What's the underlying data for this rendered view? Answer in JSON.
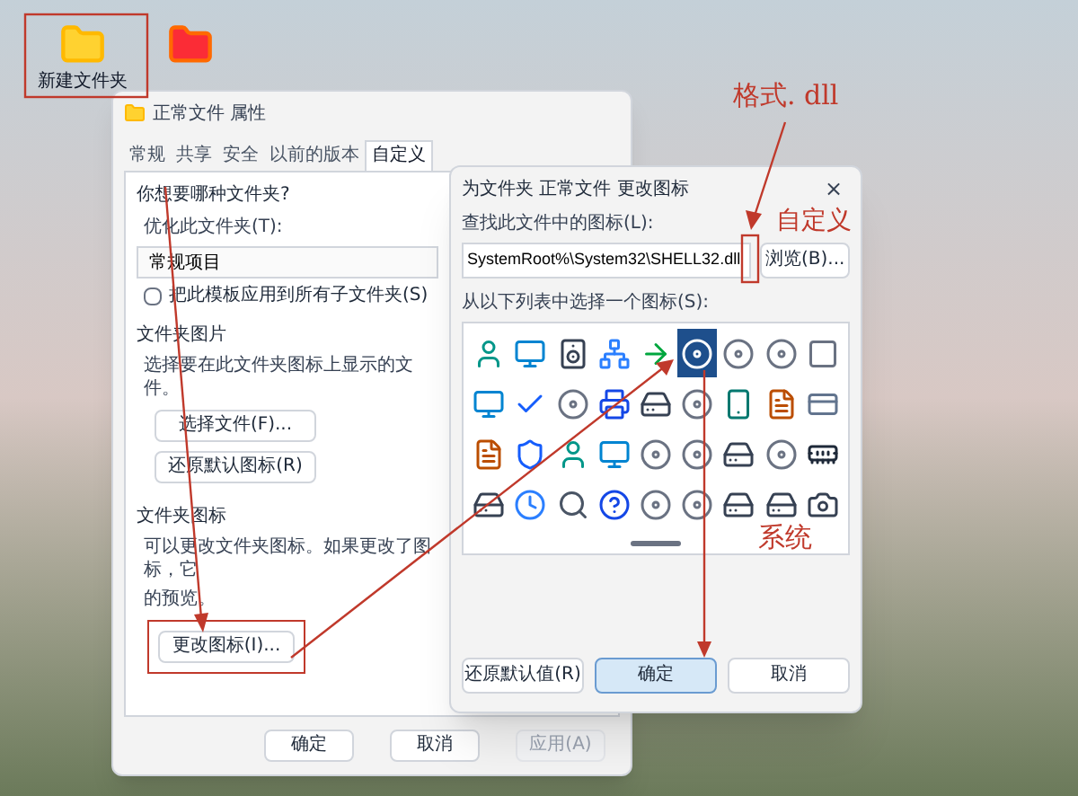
{
  "desktop": {
    "icons": [
      {
        "kind": "folder",
        "label": "新建文件夹"
      },
      {
        "kind": "folder-image"
      }
    ]
  },
  "properties_dialog": {
    "title": "正常文件 属性",
    "tabs": [
      {
        "label": "常规",
        "selected": false
      },
      {
        "label": "共享",
        "selected": false
      },
      {
        "label": "安全",
        "selected": false
      },
      {
        "label": "以前的版本",
        "selected": false
      },
      {
        "label": "自定义",
        "selected": true
      }
    ],
    "group_folder_type": {
      "heading": "你想要哪种文件夹?",
      "label": "优化此文件夹(T):",
      "value": "常规项目",
      "checkbox": {
        "label": "把此模板应用到所有子文件夹(S)",
        "checked": false
      }
    },
    "group_folder_picture": {
      "heading": "文件夹图片",
      "text": "选择要在此文件夹图标上显示的文件。",
      "buttons": [
        "选择文件(F)...",
        "还原默认图标(R)"
      ]
    },
    "group_folder_icon": {
      "heading": "文件夹图标",
      "text_lines": [
        "可以更改文件夹图标。如果更改了图标，它",
        "的预览。"
      ],
      "button": "更改图标(I)..."
    },
    "buttons": [
      {
        "label": "确定",
        "disabled": false
      },
      {
        "label": "取消",
        "disabled": false
      },
      {
        "label": "应用(A)",
        "disabled": true
      }
    ]
  },
  "icon_dialog": {
    "title": "为文件夹 正常文件 更改图标",
    "close": "×",
    "file_label": "查找此文件中的图标(L):",
    "file_value": "SystemRoot%\\System32\\SHELL32.dll",
    "browse": "浏览(B)...",
    "list_label": "从以下列表中选择一个图标(S):",
    "icons": [
      {
        "kind": "user",
        "selected": false
      },
      {
        "kind": "monitor",
        "selected": false
      },
      {
        "kind": "speaker",
        "selected": false
      },
      {
        "kind": "network",
        "selected": false
      },
      {
        "kind": "arrow",
        "selected": false
      },
      {
        "kind": "disc",
        "selected": true
      },
      {
        "kind": "disc",
        "selected": false
      },
      {
        "kind": "disc",
        "selected": false
      },
      {
        "kind": "frame",
        "selected": false
      },
      {
        "kind": "monitor",
        "selected": false
      },
      {
        "kind": "check",
        "selected": false
      },
      {
        "kind": "disc",
        "selected": false
      },
      {
        "kind": "printer",
        "selected": false
      },
      {
        "kind": "drive",
        "selected": false
      },
      {
        "kind": "disc",
        "selected": false
      },
      {
        "kind": "phone",
        "selected": false
      },
      {
        "kind": "file",
        "selected": false
      },
      {
        "kind": "card",
        "selected": false
      },
      {
        "kind": "file",
        "selected": false
      },
      {
        "kind": "shield",
        "selected": false
      },
      {
        "kind": "user",
        "selected": false
      },
      {
        "kind": "monitor",
        "selected": false
      },
      {
        "kind": "disc",
        "selected": false
      },
      {
        "kind": "disc",
        "selected": false
      },
      {
        "kind": "drive",
        "selected": false
      },
      {
        "kind": "disc",
        "selected": false
      },
      {
        "kind": "sdcard",
        "selected": false
      },
      {
        "kind": "drive",
        "selected": false
      },
      {
        "kind": "clock",
        "selected": false
      },
      {
        "kind": "search",
        "selected": false
      },
      {
        "kind": "help",
        "selected": false
      },
      {
        "kind": "disc",
        "selected": false
      },
      {
        "kind": "disc",
        "selected": false
      },
      {
        "kind": "drive",
        "selected": false
      },
      {
        "kind": "drive",
        "selected": false
      },
      {
        "kind": "camera",
        "selected": false
      }
    ],
    "buttons": [
      {
        "label": "还原默认值(R)",
        "primary": false
      },
      {
        "label": "确定",
        "primary": true
      },
      {
        "label": "取消",
        "primary": false
      }
    ]
  },
  "callouts": [
    {
      "text": "格式. dll"
    },
    {
      "text": "自定义"
    },
    {
      "text": "系统"
    }
  ]
}
